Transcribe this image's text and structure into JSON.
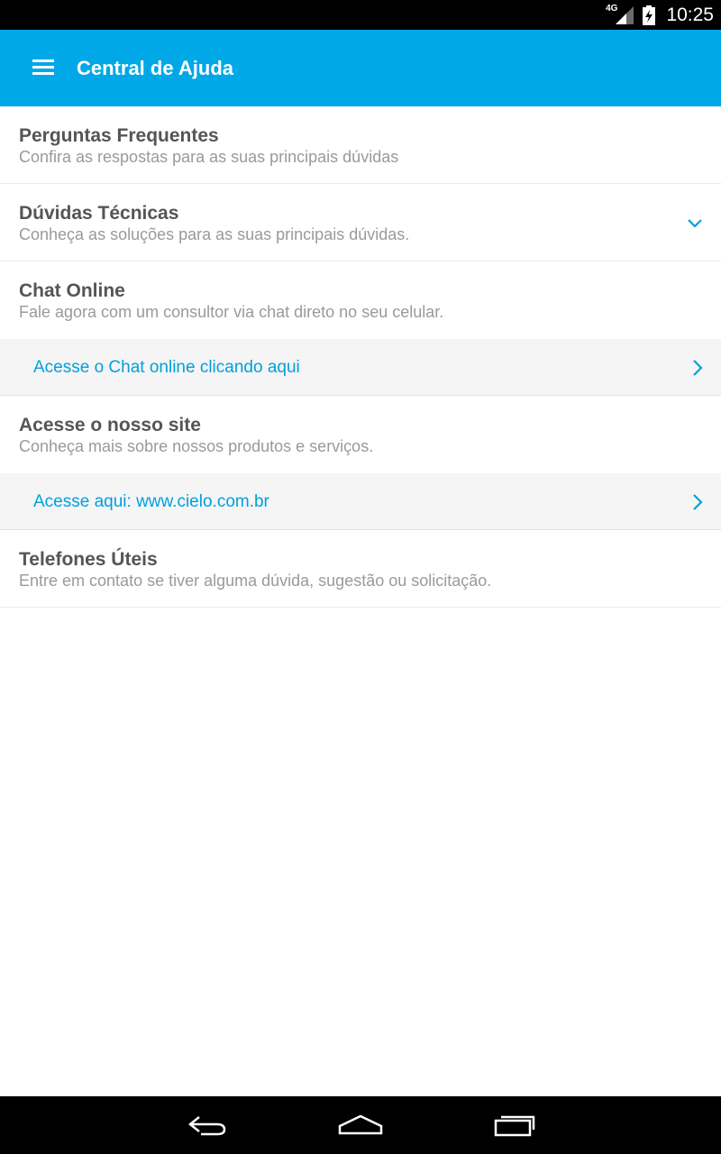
{
  "status_bar": {
    "network": "4G",
    "time": "10:25"
  },
  "app_bar": {
    "title": "Central de Ajuda",
    "menu_icon": "menu-icon"
  },
  "sections": [
    {
      "title": "Perguntas Frequentes",
      "subtitle": "Confira as respostas para as suas principais dúvidas"
    },
    {
      "title": "Dúvidas Técnicas",
      "subtitle": "Conheça as soluções para as suas principais dúvidas."
    },
    {
      "title": "Chat Online",
      "subtitle": "Fale agora com um consultor via chat direto no seu celular."
    },
    {
      "title": "Acesse o nosso site",
      "subtitle": "Conheça mais sobre nossos produtos e serviços."
    },
    {
      "title": "Telefones Úteis",
      "subtitle": "Entre em contato se tiver alguma dúvida, sugestão ou solicitação."
    }
  ],
  "links": {
    "chat": "Acesse o Chat online clicando aqui",
    "site": "Acesse aqui: www.cielo.com.br"
  },
  "colors": {
    "accent": "#00a8e8",
    "link": "#00a0dc",
    "title_text": "#555555",
    "subtitle_text": "#9a9a9a"
  },
  "nav_bar": {
    "icons": [
      "back-icon",
      "home-icon",
      "recent-apps-icon"
    ]
  }
}
